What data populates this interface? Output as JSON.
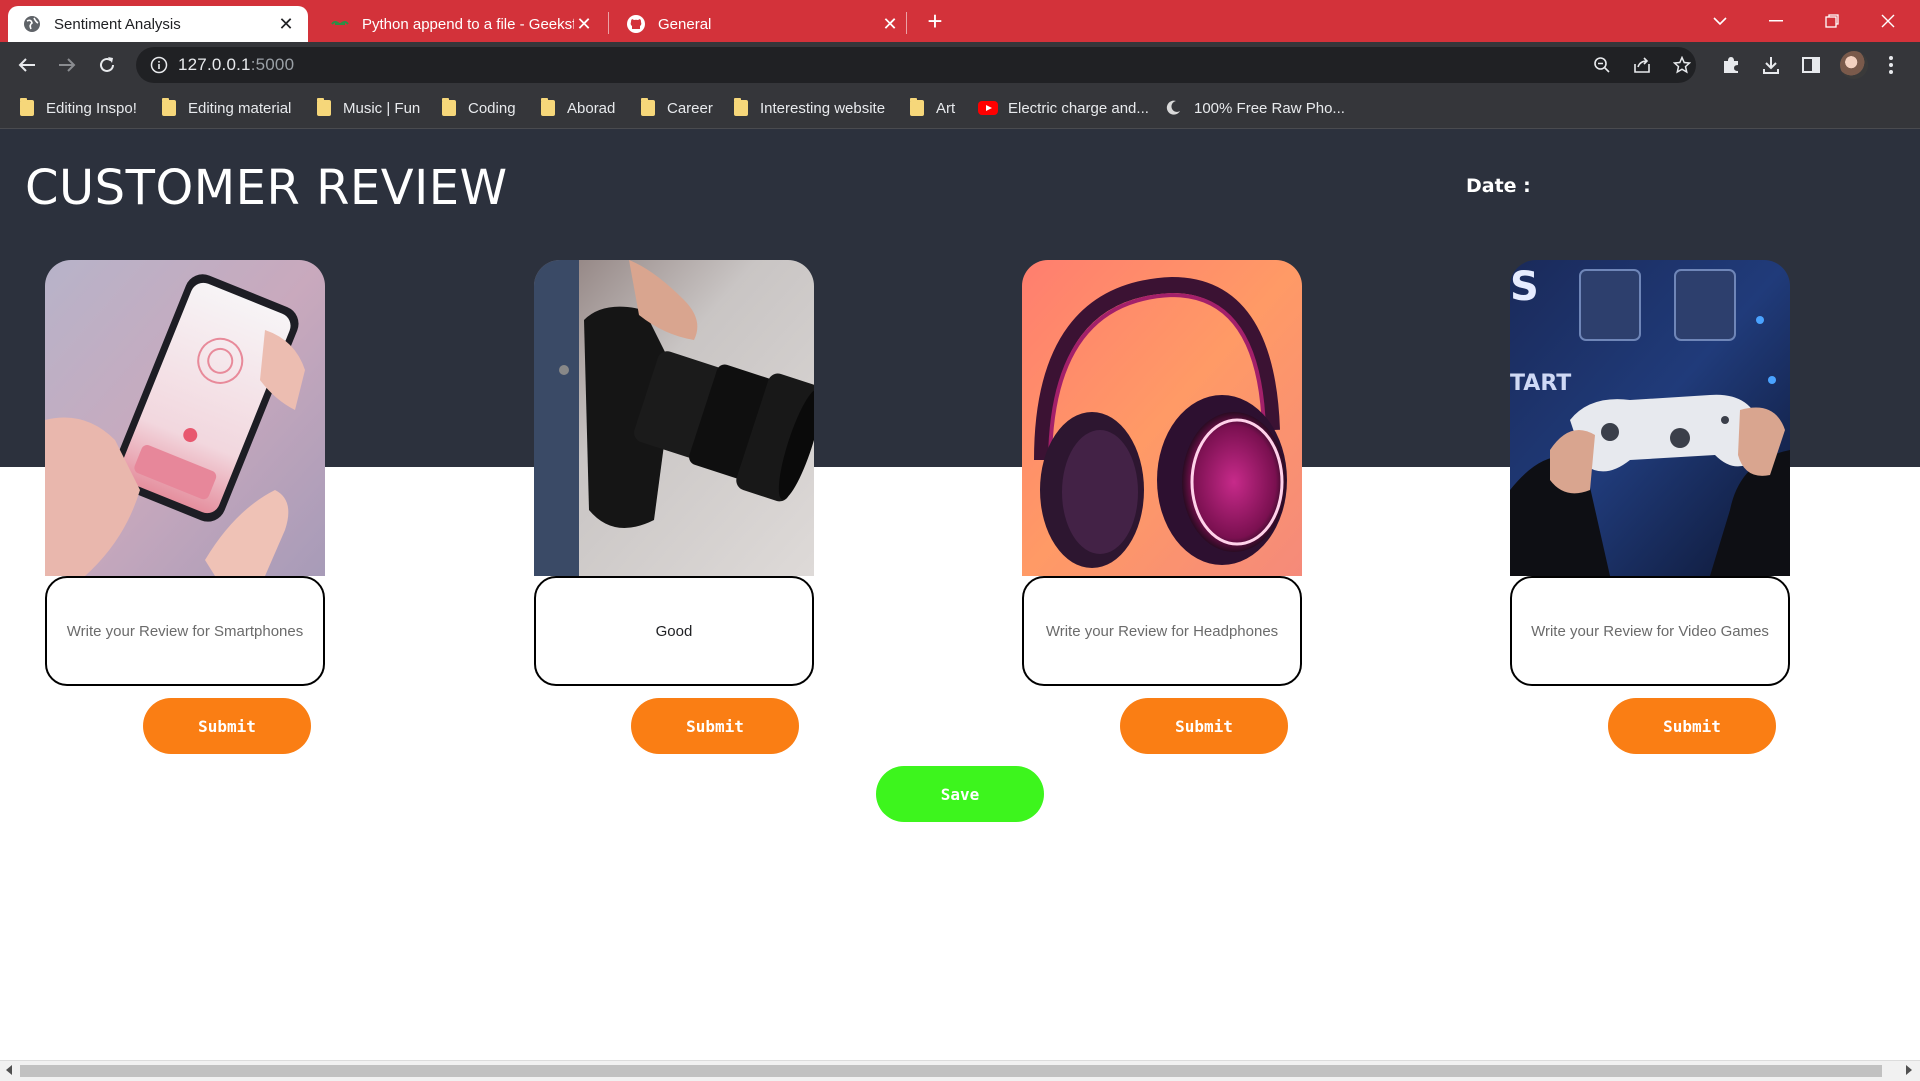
{
  "browser": {
    "tabs": [
      {
        "title": "Sentiment Analysis",
        "active": true,
        "icon": "globe-icon"
      },
      {
        "title": "Python append to a file - Geeksfo",
        "active": false,
        "icon": "geeksforgeeks-icon"
      },
      {
        "title": "General",
        "active": false,
        "icon": "github-icon"
      }
    ],
    "address": {
      "host": "127.0.0.1",
      "port": ":5000"
    },
    "bookmarks": [
      {
        "label": "Editing Inspo!",
        "icon": "folder-icon"
      },
      {
        "label": "Editing material",
        "icon": "folder-icon"
      },
      {
        "label": "Music | Fun",
        "icon": "folder-icon"
      },
      {
        "label": "Coding",
        "icon": "folder-icon"
      },
      {
        "label": "Aborad",
        "icon": "folder-icon"
      },
      {
        "label": "Career",
        "icon": "folder-icon"
      },
      {
        "label": "Interesting website",
        "icon": "folder-icon"
      },
      {
        "label": "Art",
        "icon": "folder-icon"
      },
      {
        "label": "Electric charge and...",
        "icon": "youtube-icon"
      },
      {
        "label": "100% Free Raw Pho...",
        "icon": "moon-icon"
      }
    ],
    "accent": "#d3323a"
  },
  "page": {
    "title": "CUSTOMER REVIEW",
    "date_label": "Date :",
    "header_bg": "#2c313d",
    "products": [
      {
        "name": "smartphones",
        "image": "smartphone-photo",
        "placeholder": "Write your Review for Smartphones",
        "value": "",
        "submit_label": "Submit"
      },
      {
        "name": "cameras",
        "image": "camera-photo",
        "placeholder": "",
        "value": "Good",
        "submit_label": "Submit"
      },
      {
        "name": "headphones",
        "image": "headphones-photo",
        "placeholder": "Write your Review for Headphones",
        "value": "",
        "submit_label": "Submit"
      },
      {
        "name": "video-games",
        "image": "game-controller-photo",
        "placeholder": "Write your Review for Video Games",
        "value": "",
        "submit_label": "Submit"
      }
    ],
    "submit_color": "#fa7e14",
    "save_label": "Save",
    "save_color": "#3df51d"
  }
}
